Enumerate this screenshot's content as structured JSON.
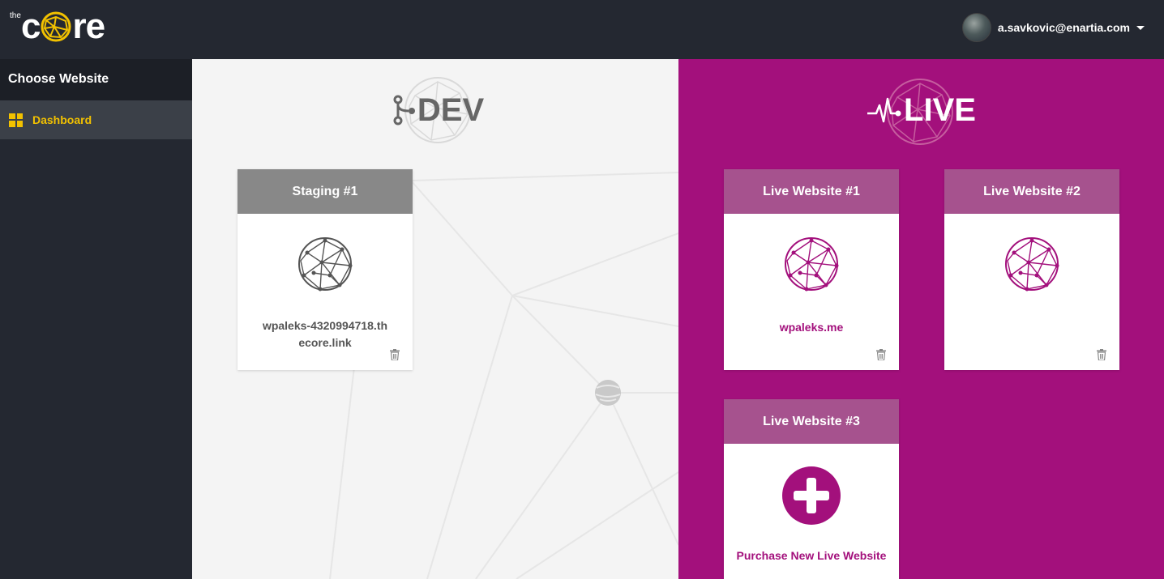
{
  "brand": {
    "the": "the",
    "core": "re",
    "core_prefix": "c"
  },
  "user": {
    "email": "a.savkovic@enartia.com"
  },
  "sidebar": {
    "title": "Choose Website",
    "items": [
      {
        "label": "Dashboard",
        "icon": "grid-icon",
        "active": true
      }
    ]
  },
  "dev": {
    "title": "DEV",
    "icon": "git-branch-icon",
    "cards": [
      {
        "title": "Staging #1",
        "link": "wpaleks-4320994718.thecore.link"
      }
    ]
  },
  "live": {
    "title": "LIVE",
    "icon": "pulse-icon",
    "cards": [
      {
        "title": "Live Website #1",
        "link": "wpaleks.me"
      },
      {
        "title": "Live Website #2",
        "link": ""
      },
      {
        "title": "Live Website #3",
        "action": "Purchase New Live Website"
      }
    ]
  },
  "colors": {
    "topbar": "#242831",
    "accent_yellow": "#f2c100",
    "live_magenta": "#a3107c",
    "live_card_header": "#a6528e",
    "dev_card_header": "#888888"
  }
}
